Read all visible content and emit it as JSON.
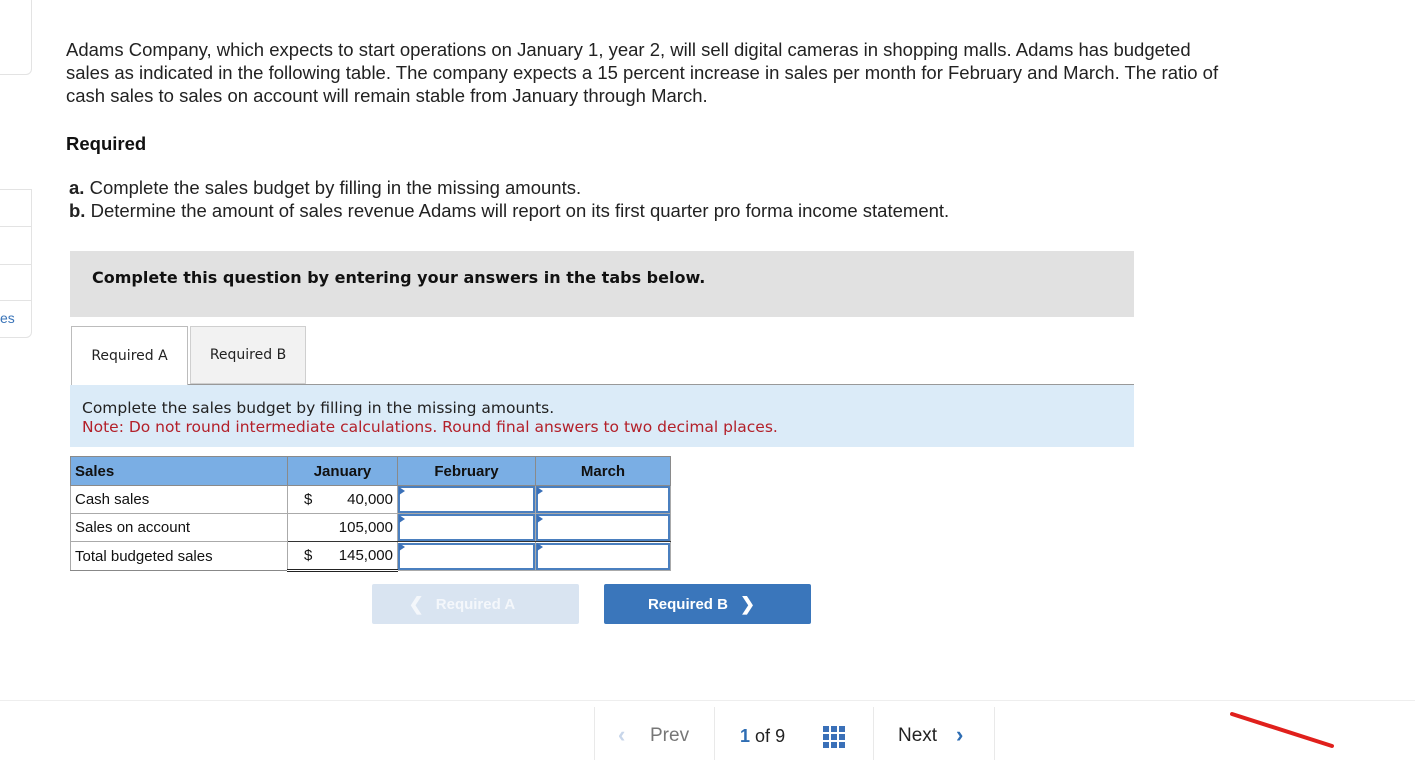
{
  "sidebar": {
    "partial_label": "es"
  },
  "problem": {
    "intro": "Adams Company, which expects to start operations on January 1, year 2, will sell digital cameras in shopping malls. Adams has budgeted sales as indicated in the following table. The company expects a 15 percent increase in sales per month for February and March. The ratio of cash sales to sales on account will remain stable from January through March.",
    "required_heading": "Required",
    "requirements": [
      {
        "letter": "a.",
        "text": " Complete the sales budget by filling in the missing amounts."
      },
      {
        "letter": "b.",
        "text": " Determine the amount of sales revenue Adams will report on its first quarter pro forma income statement."
      }
    ]
  },
  "instructions": "Complete this question by entering your answers in the tabs below.",
  "tabs": [
    {
      "label": "Required A",
      "active": true
    },
    {
      "label": "Required B",
      "active": false
    }
  ],
  "panel": {
    "prompt": "Complete the sales budget by filling in the missing amounts.",
    "note": "Note: Do not round intermediate calculations. Round final answers to two decimal places."
  },
  "table": {
    "headers": [
      "Sales",
      "January",
      "February",
      "March"
    ],
    "rows": [
      {
        "label": "Cash sales",
        "currency": "$",
        "january": "40,000",
        "february": "",
        "march": ""
      },
      {
        "label": "Sales on account",
        "currency": "",
        "january": "105,000",
        "february": "",
        "march": ""
      },
      {
        "label": "Total budgeted sales",
        "currency": "$",
        "january": "145,000",
        "february": "",
        "march": ""
      }
    ]
  },
  "nav_buttons": {
    "prev_label": "Required A",
    "next_label": "Required B",
    "prev_icon": "chevron-left-icon",
    "next_icon": "chevron-right-icon"
  },
  "pager": {
    "prev_label": "Prev",
    "current": "1",
    "of_label": "of",
    "total": "9",
    "next_label": "Next",
    "grid_icon": "grid-icon"
  },
  "colors": {
    "accent": "#3a76bb",
    "table_header": "#7aaee4",
    "note_red": "#b3202a",
    "panel_bg": "#dbebf8",
    "annotation_red": "#e0201c"
  }
}
